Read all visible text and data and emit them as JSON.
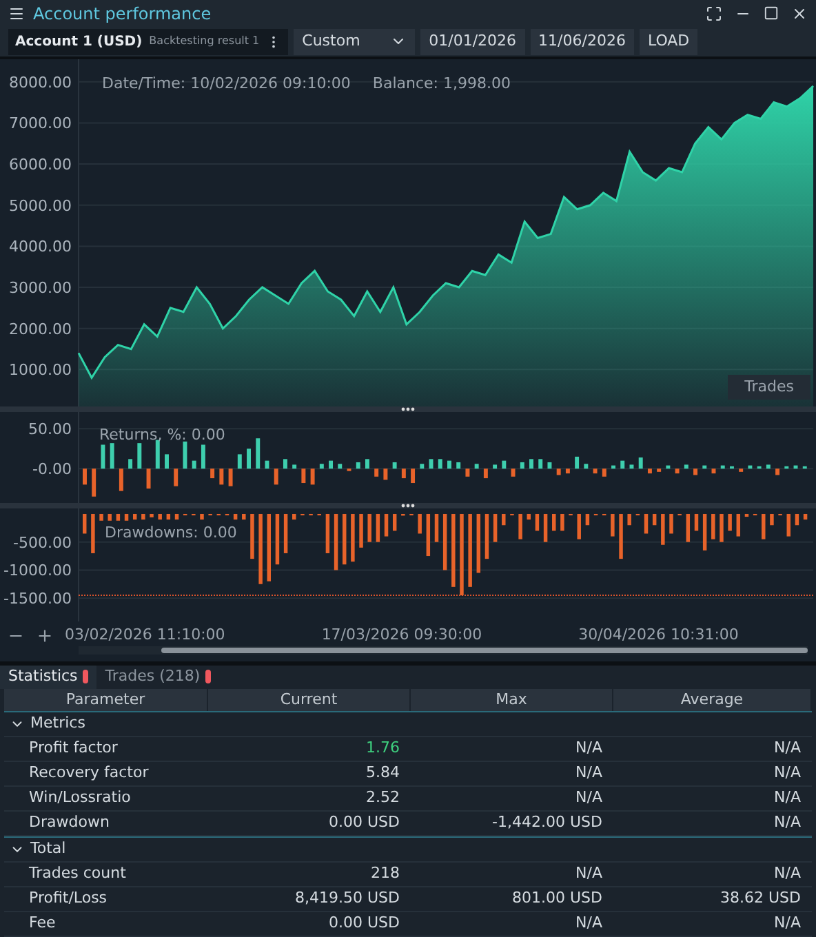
{
  "window": {
    "title": "Account performance"
  },
  "toolbar": {
    "account": "Account 1 (USD)",
    "source": "Backtesting result 1",
    "period": "Custom",
    "date_from": "01/01/2026",
    "date_to": "11/06/2026",
    "load_button": "LOAD"
  },
  "balance_chart": {
    "info": "Date/Time: 10/02/2026 09:10:00",
    "balance": "Balance: 1,998.00",
    "trades_button": "Trades",
    "chart_data": {
      "type": "area",
      "grid": true,
      "ylim": [
        0,
        8550
      ],
      "yticks": [
        {
          "value": 1000,
          "label": "1000.00"
        },
        {
          "value": 2000,
          "label": "2000.00"
        },
        {
          "value": 3000,
          "label": "3000.00"
        },
        {
          "value": 4000,
          "label": "4000.00"
        },
        {
          "value": 5000,
          "label": "5000.00"
        },
        {
          "value": 6000,
          "label": "6000.00"
        },
        {
          "value": 7000,
          "label": "7000.00"
        },
        {
          "value": 8000,
          "label": "8000.00"
        }
      ],
      "series": [
        {
          "color": "#2fd3a8",
          "values": [
            1400,
            800,
            1300,
            1600,
            1500,
            2100,
            1800,
            2500,
            2400,
            3000,
            2600,
            2000,
            2300,
            2700,
            3000,
            2800,
            2600,
            3100,
            3400,
            2900,
            2700,
            2300,
            2900,
            2400,
            3000,
            2100,
            2400,
            2800,
            3100,
            3000,
            3400,
            3300,
            3800,
            3600,
            4600,
            4200,
            4300,
            5200,
            4900,
            5000,
            5300,
            5100,
            6300,
            5800,
            5600,
            5900,
            5800,
            6500,
            6900,
            6600,
            7000,
            7200,
            7100,
            7500,
            7400,
            7600,
            7900
          ]
        }
      ]
    }
  },
  "returns_chart": {
    "label": "Returns, %: 0.00",
    "chart_data": {
      "type": "bar",
      "grid": true,
      "ylim": [
        -43,
        71
      ],
      "yticks": [
        {
          "value": 50,
          "label": "50.00"
        },
        {
          "value": 0,
          "label": "-0.00"
        }
      ],
      "series": [
        {
          "color": "#3ecfae",
          "values": [
            null,
            null,
            30,
            32,
            null,
            12,
            32,
            null,
            36,
            18,
            null,
            34,
            10,
            30,
            null,
            null,
            null,
            18,
            25,
            38,
            10,
            null,
            12,
            5,
            null,
            null,
            6,
            10,
            6,
            null,
            8,
            12,
            null,
            null,
            8,
            null,
            null,
            6,
            12,
            12,
            10,
            8,
            null,
            6,
            null,
            5,
            10,
            null,
            8,
            12,
            12,
            8,
            null,
            null,
            15,
            6,
            null,
            null,
            4,
            10,
            5,
            14,
            null,
            null,
            4,
            null,
            5,
            null,
            4,
            null,
            4,
            3,
            null,
            4,
            3,
            5,
            null,
            3,
            4,
            3
          ]
        },
        {
          "color": "#e8632a",
          "values": [
            -20,
            -35,
            null,
            null,
            -28,
            null,
            null,
            -25,
            null,
            null,
            -22,
            null,
            null,
            null,
            -12,
            -20,
            -22,
            null,
            null,
            null,
            null,
            -20,
            null,
            null,
            -18,
            -20,
            null,
            null,
            null,
            -3,
            null,
            null,
            -10,
            -14,
            null,
            -12,
            -18,
            null,
            null,
            null,
            null,
            null,
            -10,
            null,
            -12,
            null,
            null,
            -10,
            null,
            null,
            null,
            null,
            -8,
            -6,
            null,
            null,
            -6,
            -10,
            null,
            null,
            null,
            null,
            -6,
            -4,
            null,
            -6,
            null,
            -8,
            null,
            -6,
            null,
            null,
            -4,
            null,
            null,
            null,
            -8,
            null,
            null,
            null
          ]
        }
      ]
    }
  },
  "drawdowns_chart": {
    "label": "Drawdowns: 0.00",
    "chart_data": {
      "type": "bar",
      "grid": true,
      "ylim": [
        -1916,
        98
      ],
      "yticks": [
        {
          "value": -500,
          "label": "-500.00"
        },
        {
          "value": -1000,
          "label": "-1000.00"
        },
        {
          "value": -1500,
          "label": "-1500.00"
        }
      ],
      "ref_lines": [
        {
          "axis": "y",
          "value": -1450,
          "color": "#d9532c"
        }
      ],
      "series": [
        {
          "color": "#e8632a",
          "values": [
            -350,
            -700,
            -120,
            -120,
            -120,
            -120,
            -100,
            -100,
            -60,
            -100,
            -100,
            -100,
            0,
            0,
            -100,
            0,
            0,
            0,
            -100,
            -100,
            -800,
            -1250,
            -1200,
            -900,
            -700,
            -100,
            0,
            0,
            0,
            -700,
            -1000,
            -900,
            -850,
            -600,
            -500,
            -500,
            -400,
            -300,
            -30,
            0,
            -350,
            -750,
            -500,
            -1000,
            -1300,
            -1450,
            -1300,
            -1050,
            -800,
            -500,
            -200,
            0,
            -450,
            -100,
            -300,
            -500,
            -300,
            -300,
            0,
            -450,
            -200,
            0,
            0,
            -400,
            -800,
            -200,
            0,
            -350,
            -200,
            -550,
            -350,
            0,
            -500,
            -300,
            -650,
            -450,
            -500,
            -300,
            -400,
            -50,
            0,
            -450,
            -200,
            0,
            -400,
            -200,
            -100
          ]
        }
      ]
    }
  },
  "time_axis": [
    "03/02/2026 11:10:00",
    "17/03/2026 09:30:00",
    "30/04/2026 10:31:00"
  ],
  "tabs": [
    {
      "label": "Statistics",
      "selected": true
    },
    {
      "label": "Trades (218)",
      "selected": false
    }
  ],
  "table": {
    "columns": [
      "Parameter",
      "Current",
      "Max",
      "Average"
    ],
    "groups": [
      {
        "name": "Metrics",
        "expanded": true,
        "rows": [
          {
            "cells": [
              "Profit factor",
              "1.76",
              "N/A",
              "N/A"
            ],
            "positive": true
          },
          {
            "cells": [
              "Recovery factor",
              "5.84",
              "N/A",
              "N/A"
            ],
            "positive": false
          },
          {
            "cells": [
              "Win/Lossratio",
              "2.52",
              "N/A",
              "N/A"
            ],
            "positive": false
          },
          {
            "cells": [
              "Drawdown",
              "0.00 USD",
              "-1,442.00 USD",
              "N/A"
            ],
            "positive": false
          }
        ]
      },
      {
        "name": "Total",
        "expanded": true,
        "rows": [
          {
            "cells": [
              "Trades count",
              "218",
              "N/A",
              "N/A"
            ],
            "positive": false
          },
          {
            "cells": [
              "Profit/Loss",
              "8,419.50 USD",
              "801.00 USD",
              "38.62 USD"
            ],
            "positive": false
          },
          {
            "cells": [
              "Fee",
              "0.00 USD",
              "N/A",
              "N/A"
            ],
            "positive": false
          }
        ]
      }
    ]
  }
}
